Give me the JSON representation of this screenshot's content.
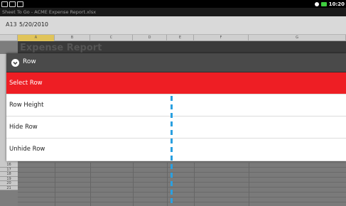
{
  "status_bar": {
    "time": "10:20"
  },
  "app_title": "Sheet To Go - ACME Expense Report.xlsx",
  "formula_bar": {
    "cell_ref": "A13",
    "cell_value": "5/20/2010"
  },
  "sheet": {
    "columns": [
      "A",
      "B",
      "C",
      "D",
      "E",
      "F",
      "G"
    ],
    "selected_column": "A",
    "title": "Expense Report",
    "row_numbers": [
      "16",
      "17",
      "18",
      "19",
      "20",
      "21"
    ]
  },
  "dialog": {
    "title": "Row",
    "items": [
      {
        "label": "Select Row",
        "selected": true
      },
      {
        "label": "Row Height",
        "selected": false
      },
      {
        "label": "Hide Row",
        "selected": false
      },
      {
        "label": "Unhide Row",
        "selected": false
      }
    ]
  },
  "colors": {
    "accent": "#ee1e24",
    "divider": "#2aa0e0",
    "dialog_header": "#4a4a4a"
  }
}
